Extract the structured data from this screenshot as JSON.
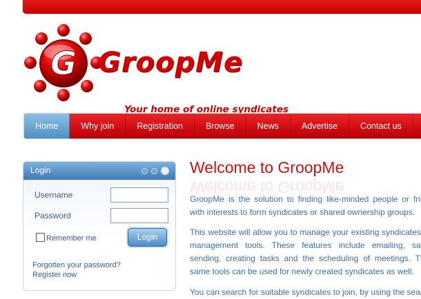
{
  "brand": {
    "name": "GroopMe",
    "tagline": "Your home of online syndicates"
  },
  "nav": {
    "items": [
      "Home",
      "Why join",
      "Registration",
      "Browse",
      "News",
      "Advertise",
      "Contact us"
    ],
    "active": "Home"
  },
  "login": {
    "title": "Login",
    "username_label": "Username",
    "password_label": "Password",
    "remember_label": "Remember me",
    "button_label": "Login",
    "forgot_link": "Forgotten your password?",
    "register_link": "Register now"
  },
  "content": {
    "heading": "Welcome to GroopMe",
    "paragraphs": [
      "GroopMe is the solution to finding like-minded people or friends with interests to form syndicates or shared ownership groups.",
      "This website will allow you to manage your existing syndicates with management tools. These features include emailing, saving, sending, creating tasks and the scheduling of meetings. These same tools can be used for newly created syndicates as well.",
      "You can search for suitable syndicates to join, by using the search"
    ]
  },
  "colors": {
    "brand_red": "#d40000",
    "nav_active_blue": "#4f8fc4",
    "text_blue": "#3e6fa3"
  }
}
